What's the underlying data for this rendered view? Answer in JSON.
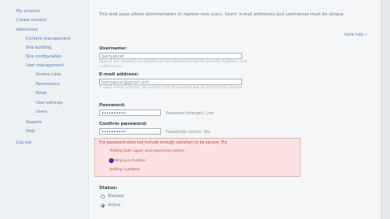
{
  "sidebar": {
    "items": [
      {
        "label": "My account"
      },
      {
        "label": "Create content"
      },
      {
        "label": "Administer"
      },
      {
        "label": "Content management"
      },
      {
        "label": "Site building"
      },
      {
        "label": "Site configuration"
      },
      {
        "label": "User management"
      },
      {
        "label": "Access rules"
      },
      {
        "label": "Permissions"
      },
      {
        "label": "Roles"
      },
      {
        "label": "User settings"
      },
      {
        "label": "Users"
      },
      {
        "label": "Reports"
      },
      {
        "label": "Help"
      },
      {
        "label": "Log out"
      }
    ]
  },
  "main": {
    "intro": "This web page allows administrators to register new users. Users' e-mail addresses and usernames must be unique.",
    "more_help": "more help »",
    "username": {
      "label": "Username:",
      "value": "barryapcar",
      "description": "Spaces are allowed; punctuation is not allowed except for periods, hyphens, and underscores."
    },
    "email": {
      "label": "E-mail address:",
      "value": "barryapcar@gmail.com",
      "description": "A valid e-mail address. All e-mails from the system will be sent to this address."
    },
    "password": {
      "label": "Password:",
      "value": "••••••••••",
      "strength_label": "Password strength:",
      "strength_value": "Low"
    },
    "confirm": {
      "label": "Confirm password:",
      "value": "••••••••••",
      "match_label": "Passwords match:",
      "match_value": "Yes"
    },
    "error": {
      "heading": "The password does not include enough variation to be secure. Try:",
      "suggestions": [
        "Adding both upper and lowercase letters.",
        "Adding punctuation.",
        "Adding numbers."
      ]
    },
    "status": {
      "label": "Status:",
      "options": [
        "Blocked",
        "Active"
      ],
      "selected": "Active"
    }
  }
}
